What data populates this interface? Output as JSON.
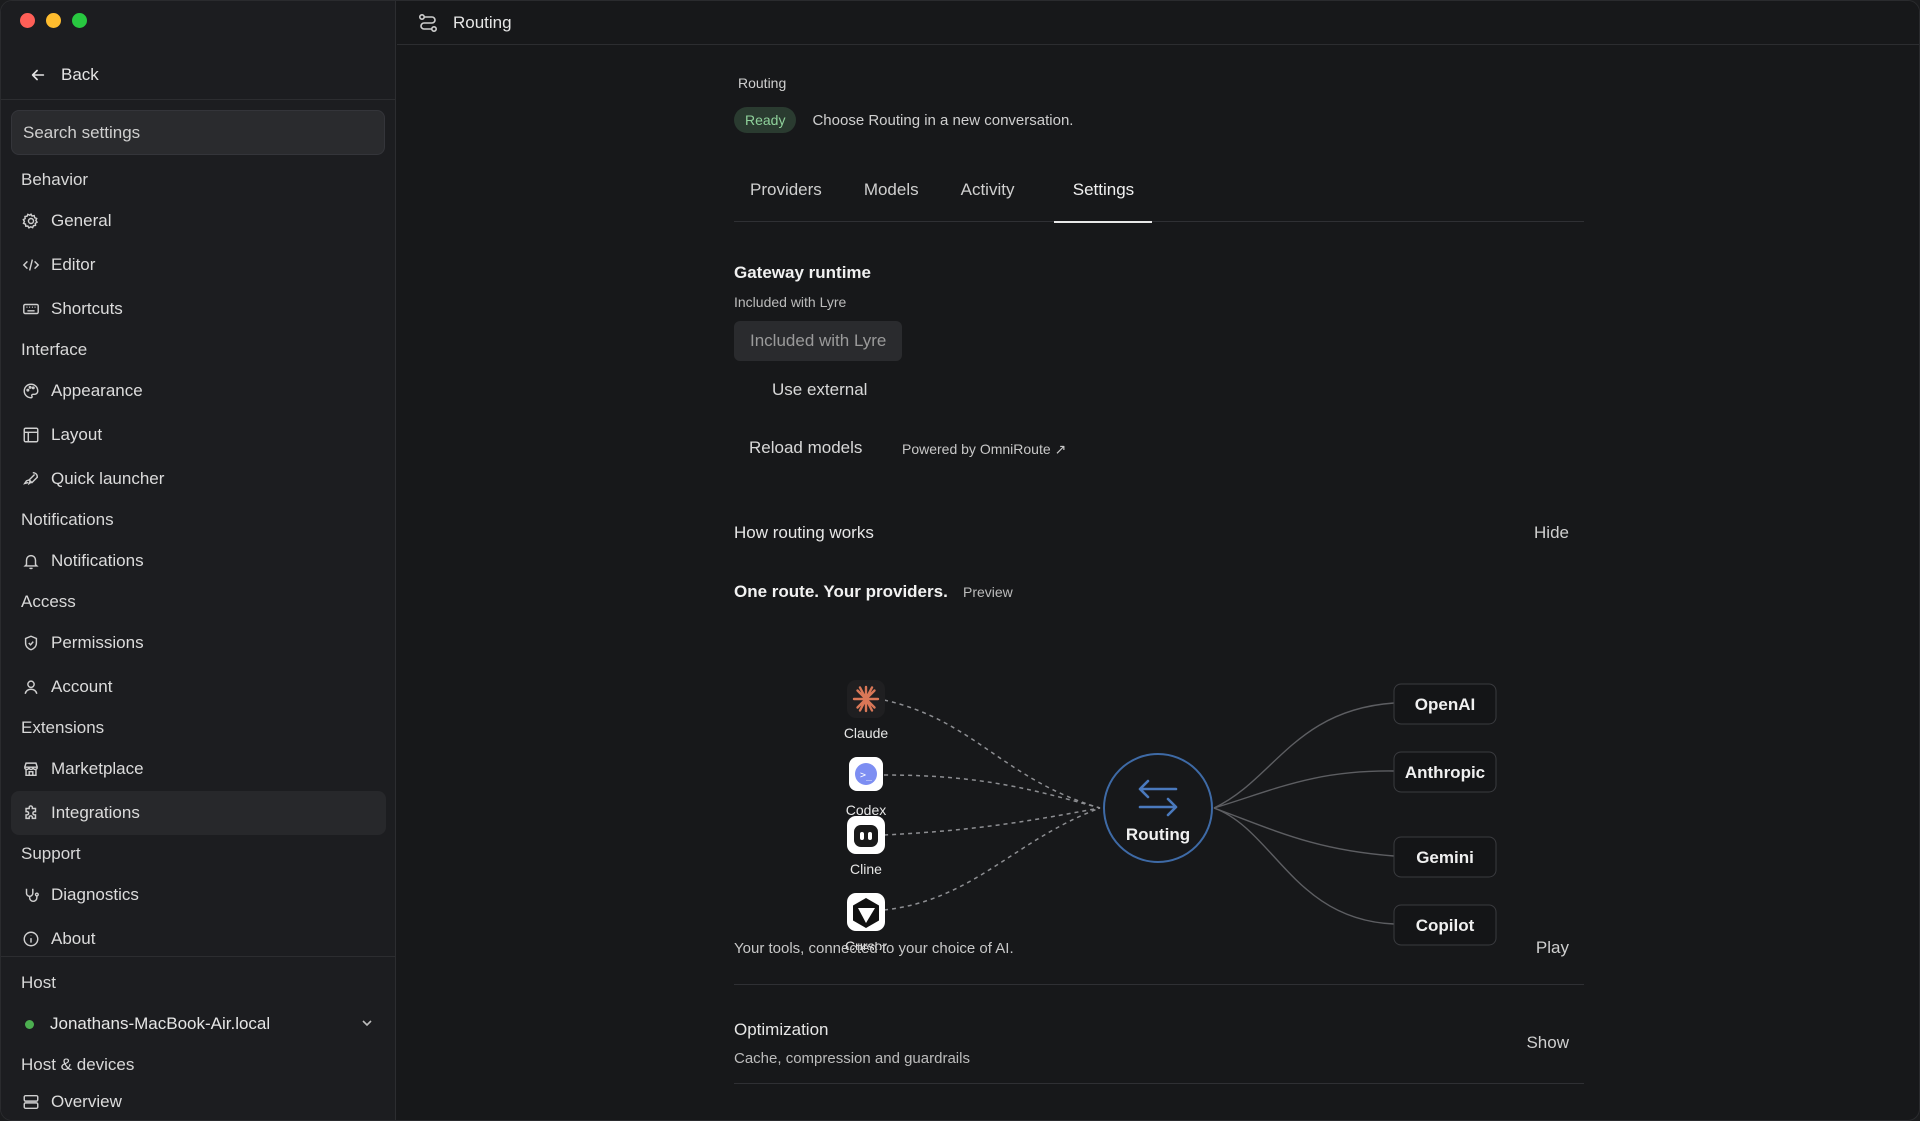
{
  "sidebar": {
    "back_label": "Back",
    "search_placeholder": "Search settings",
    "sections": [
      {
        "title": "Behavior",
        "items": [
          {
            "label": "General",
            "icon": "gear-icon"
          },
          {
            "label": "Editor",
            "icon": "code-icon"
          },
          {
            "label": "Shortcuts",
            "icon": "keyboard-icon"
          }
        ]
      },
      {
        "title": "Interface",
        "items": [
          {
            "label": "Appearance",
            "icon": "palette-icon"
          },
          {
            "label": "Layout",
            "icon": "layout-icon"
          },
          {
            "label": "Quick launcher",
            "icon": "rocket-icon"
          }
        ]
      },
      {
        "title": "Notifications",
        "items": [
          {
            "label": "Notifications",
            "icon": "bell-icon"
          }
        ]
      },
      {
        "title": "Access",
        "items": [
          {
            "label": "Permissions",
            "icon": "shield-icon"
          },
          {
            "label": "Account",
            "icon": "user-icon"
          }
        ]
      },
      {
        "title": "Extensions",
        "items": [
          {
            "label": "Marketplace",
            "icon": "store-icon"
          },
          {
            "label": "Integrations",
            "icon": "puzzle-icon",
            "active": true
          }
        ]
      },
      {
        "title": "Support",
        "items": [
          {
            "label": "Diagnostics",
            "icon": "stethoscope-icon"
          },
          {
            "label": "About",
            "icon": "info-icon"
          }
        ]
      }
    ],
    "host_title": "Host",
    "host_name": "Jonathans-MacBook-Air.local",
    "host_status_color": "#4caf50",
    "devices_title": "Host & devices",
    "overview_label": "Overview"
  },
  "topbar": {
    "title": "Routing",
    "icon": "routing-icon"
  },
  "main": {
    "breadcrumb": "Routing",
    "status_badge": "Ready",
    "status_text": "Choose Routing in a new conversation.",
    "tabs": [
      {
        "label": "Providers"
      },
      {
        "label": "Models"
      },
      {
        "label": "Activity"
      },
      {
        "label": "Settings",
        "active": true
      }
    ],
    "gateway": {
      "title": "Gateway runtime",
      "subtitle": "Included with Lyre",
      "option_selected": "Included with Lyre",
      "option_alt": "Use external"
    },
    "reload_label": "Reload models",
    "powered_label": "Powered by OmniRoute ↗",
    "how_title": "How routing works",
    "hide_label": "Hide",
    "one_route_title": "One route. Your providers.",
    "preview_label": "Preview",
    "diagram": {
      "tools": [
        {
          "label": "Claude",
          "icon": "claude-icon"
        },
        {
          "label": "Codex",
          "icon": "codex-icon"
        },
        {
          "label": "Cline",
          "icon": "cline-icon"
        },
        {
          "label": "Cursor",
          "icon": "cursor-icon"
        }
      ],
      "hub_label": "Routing",
      "providers": [
        {
          "label": "OpenAI"
        },
        {
          "label": "Anthropic"
        },
        {
          "label": "Gemini"
        },
        {
          "label": "Copilot"
        }
      ]
    },
    "tagline": "Your tools, connected to your choice of AI.",
    "play_label": "Play",
    "optimization_title": "Optimization",
    "optimization_sub": "Cache, compression and guardrails",
    "show_label": "Show"
  },
  "colors": {
    "accent_ring": "#3e6aa6",
    "badge_bg": "#2a3b30",
    "badge_text": "#8fd19b"
  }
}
